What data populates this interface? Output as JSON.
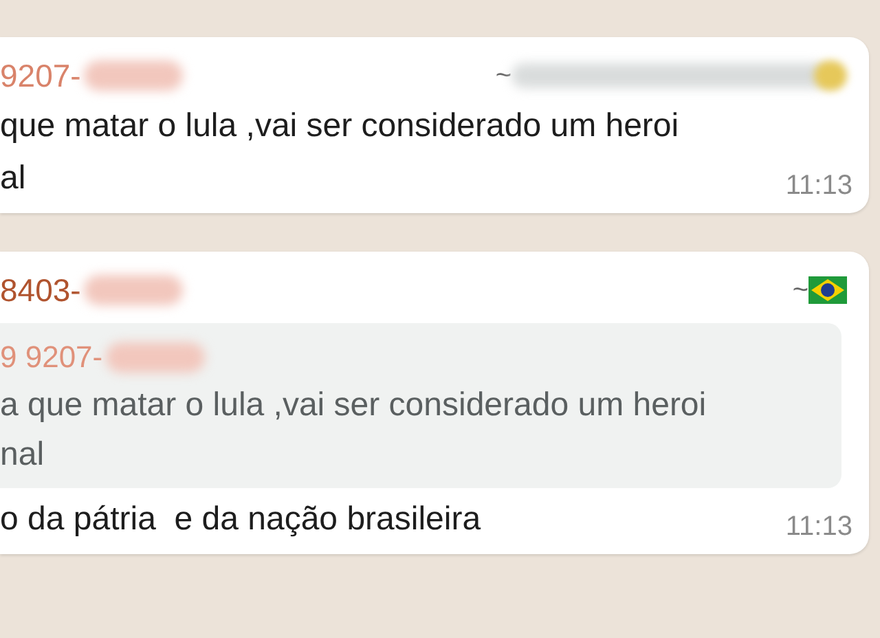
{
  "messages": [
    {
      "sender": "9207-",
      "sender_tail": "~",
      "flag": false,
      "lines": [
        "que matar o lula ,vai ser considerado um heroi",
        "al"
      ],
      "time": "11:13"
    },
    {
      "sender": "8403-",
      "sender_tail": "~",
      "flag": true,
      "quote": {
        "sender": "9 9207-",
        "lines": [
          "a que matar o lula ,vai ser considerado um heroi",
          "nal"
        ]
      },
      "lines": [
        "o da pátria  e da nação brasileira"
      ],
      "time": "11:13"
    }
  ]
}
